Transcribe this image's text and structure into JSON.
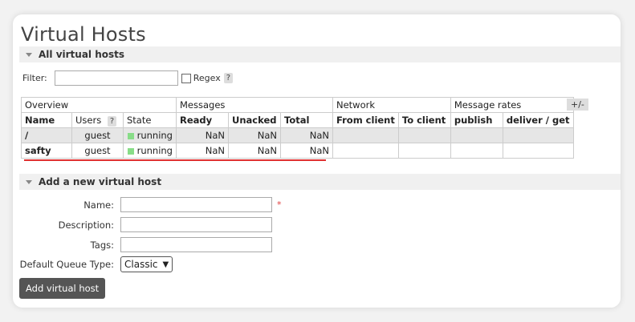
{
  "page": {
    "title": "Virtual Hosts"
  },
  "all_section": {
    "label": "All virtual hosts"
  },
  "filter": {
    "label": "Filter:",
    "value": "",
    "regex_label": "Regex",
    "help": "?"
  },
  "table": {
    "groups": [
      "Overview",
      "Messages",
      "Network",
      "Message rates"
    ],
    "toggle": "+/-",
    "headers": [
      "Name",
      "Users",
      "State",
      "Ready",
      "Unacked",
      "Total",
      "From client",
      "To client",
      "publish",
      "deliver / get"
    ],
    "users_help": "?",
    "rows": [
      {
        "name": "/",
        "users": "guest",
        "state": "running",
        "ready": "NaN",
        "unacked": "NaN",
        "total": "NaN",
        "from_client": "",
        "to_client": "",
        "publish": "",
        "deliver": ""
      },
      {
        "name": "safty",
        "users": "guest",
        "state": "running",
        "ready": "NaN",
        "unacked": "NaN",
        "total": "NaN",
        "from_client": "",
        "to_client": "",
        "publish": "",
        "deliver": ""
      }
    ]
  },
  "add_section": {
    "label": "Add a new virtual host"
  },
  "form": {
    "name_label": "Name:",
    "name_value": "",
    "required_mark": "*",
    "description_label": "Description:",
    "description_value": "",
    "tags_label": "Tags:",
    "tags_value": "",
    "queue_type_label": "Default Queue Type:",
    "queue_type_value": "Classic",
    "submit_label": "Add virtual host"
  },
  "colors": {
    "running": "#88dd88",
    "highlight": "#e03030",
    "button": "#555555"
  }
}
